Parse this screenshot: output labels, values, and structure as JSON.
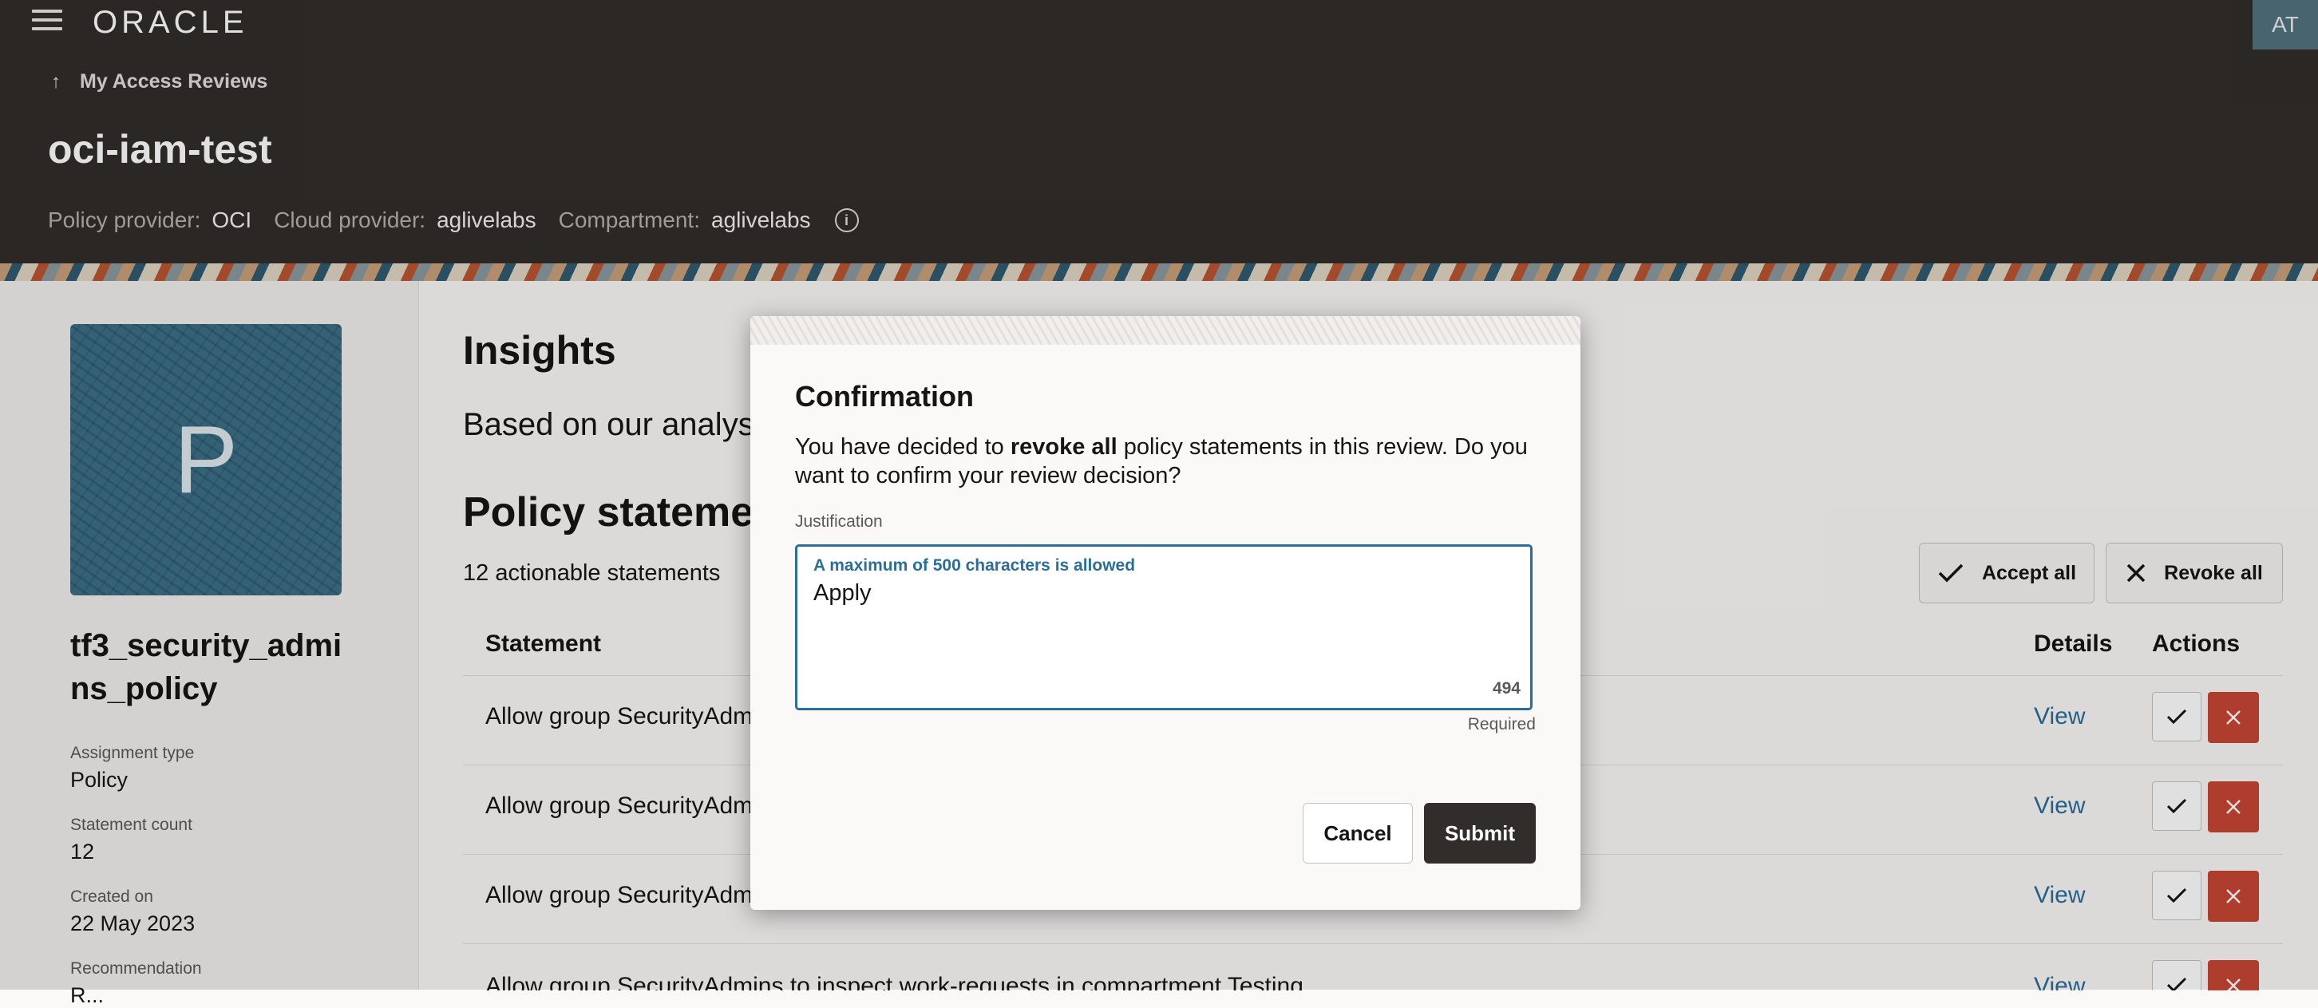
{
  "header": {
    "logo": "ORACLE",
    "avatar_initials": "AT",
    "back_link": "My Access Reviews",
    "title": "oci-iam-test",
    "meta": [
      {
        "label": "Policy provider:",
        "value": "OCI"
      },
      {
        "label": "Cloud provider:",
        "value": "aglivelabs"
      },
      {
        "label": "Compartment:",
        "value": "aglivelabs"
      }
    ]
  },
  "left_panel": {
    "avatar_letter": "P",
    "policy_name": "tf3_security_admins_policy",
    "fields": [
      {
        "label": "Assignment type",
        "value": "Policy"
      },
      {
        "label": "Statement count",
        "value": "12"
      },
      {
        "label": "Created on",
        "value": "22 May 2023"
      },
      {
        "label": "Recommendation",
        "value": "R..."
      }
    ]
  },
  "main": {
    "insights_title": "Insights",
    "insights_text": "Based on our analys",
    "statements_title": "Policy stateme",
    "actionable_count": "12 actionable statements",
    "accept_all_label": "Accept all",
    "revoke_all_label": "Revoke all",
    "columns": {
      "statement": "Statement",
      "details": "Details",
      "actions": "Actions"
    },
    "rows": [
      {
        "statement": "Allow group SecurityAdmin",
        "details": "View"
      },
      {
        "statement": "Allow group SecurityAdmin",
        "details": "View"
      },
      {
        "statement": "Allow group SecurityAdmin",
        "details": "View"
      },
      {
        "statement": "Allow group SecurityAdmins to inspect work-requests in compartment Testing",
        "details": "View"
      }
    ]
  },
  "dialog": {
    "title": "Confirmation",
    "message_pre": "You have decided to ",
    "message_bold": "revoke all",
    "message_post": " policy statements in this review. Do you want to confirm your review decision?",
    "justification_label": "Justification",
    "hint": "A maximum of 500 characters is allowed",
    "value": "Apply",
    "remaining": "494",
    "required": "Required",
    "cancel_label": "Cancel",
    "submit_label": "Submit"
  },
  "colors": {
    "header_bg": "#312d2a",
    "accent_blue": "#2a6e99",
    "revoke_red": "#c74634"
  }
}
